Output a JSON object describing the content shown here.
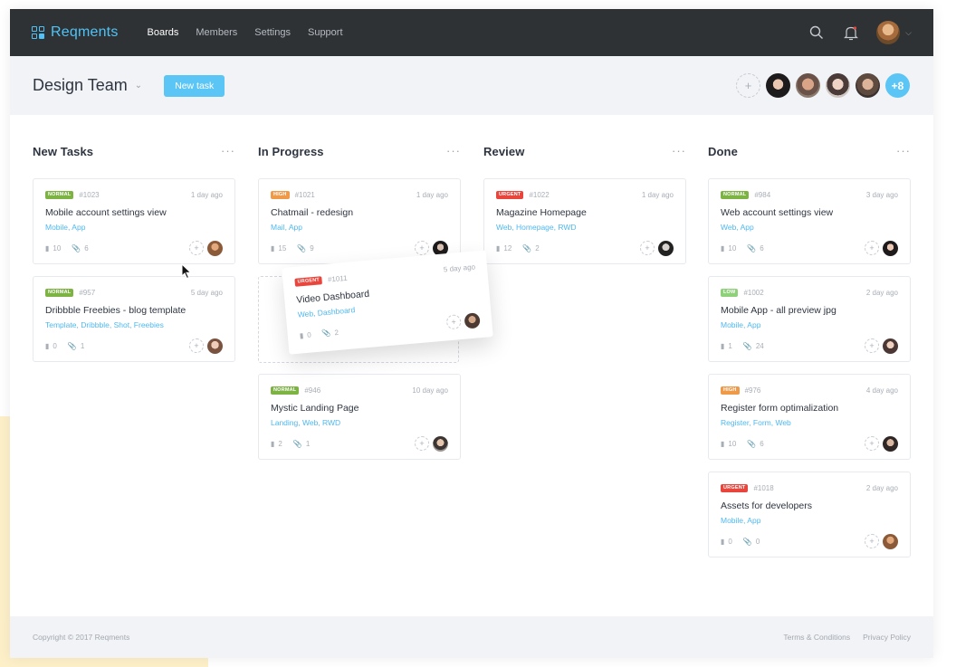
{
  "app": {
    "name": "Reqments"
  },
  "nav": {
    "links": [
      {
        "label": "Boards",
        "active": true
      },
      {
        "label": "Members",
        "active": false
      },
      {
        "label": "Settings",
        "active": false
      },
      {
        "label": "Support",
        "active": false
      }
    ],
    "icons": [
      "search-icon",
      "bell-icon",
      "chevron-down-icon"
    ]
  },
  "header": {
    "team_name": "Design Team",
    "new_task_label": "New task",
    "members_more": "+8",
    "add_member_symbol": "+"
  },
  "colors": {
    "accent": "#5bc5f5",
    "navbar": "#2f3234",
    "normal": "#7cb342",
    "high": "#ef9a48",
    "urgent": "#e8453c",
    "low": "#8fd07a"
  },
  "columns": [
    {
      "title": "New Tasks",
      "cards": [
        {
          "priority": "NORMAL",
          "id": "#1023",
          "time": "1 day ago",
          "title": "Mobile account settings view",
          "tags": "Mobile, App",
          "comments": "10",
          "attachments": "6"
        },
        {
          "priority": "NORMAL",
          "id": "#957",
          "time": "5 day ago",
          "title": "Dribbble Freebies - blog template",
          "tags": "Template, Dribbble, Shot, Freebies",
          "comments": "0",
          "attachments": "1"
        }
      ]
    },
    {
      "title": "In Progress",
      "cards": [
        {
          "priority": "HIGH",
          "id": "#1021",
          "time": "1 day ago",
          "title": "Chatmail - redesign",
          "tags": "Mail, App",
          "comments": "15",
          "attachments": "9"
        },
        {
          "priority": "NORMAL",
          "id": "#946",
          "time": "10 day ago",
          "title": "Mystic Landing Page",
          "tags": "Landing, Web, RWD",
          "comments": "2",
          "attachments": "1"
        }
      ]
    },
    {
      "title": "Review",
      "cards": [
        {
          "priority": "URGENT",
          "id": "#1022",
          "time": "1 day ago",
          "title": "Magazine Homepage",
          "tags": "Web, Homepage, RWD",
          "comments": "12",
          "attachments": "2"
        }
      ]
    },
    {
      "title": "Done",
      "cards": [
        {
          "priority": "NORMAL",
          "id": "#984",
          "time": "3 day ago",
          "title": "Web account settings view",
          "tags": "Web, App",
          "comments": "10",
          "attachments": "6"
        },
        {
          "priority": "LOW",
          "id": "#1002",
          "time": "2 day ago",
          "title": "Mobile App - all preview jpg",
          "tags": "Mobile, App",
          "comments": "1",
          "attachments": "24"
        },
        {
          "priority": "HIGH",
          "id": "#976",
          "time": "4 day ago",
          "title": "Register form optimalization",
          "tags": "Register, Form, Web",
          "comments": "10",
          "attachments": "6"
        },
        {
          "priority": "URGENT",
          "id": "#1018",
          "time": "2 day ago",
          "title": "Assets for developers",
          "tags": "Mobile, App",
          "comments": "0",
          "attachments": "0"
        }
      ]
    }
  ],
  "dragging": {
    "priority": "URGENT",
    "id": "#1011",
    "time": "5 day ago",
    "title": "Video Dashboard",
    "tags": "Web, Dashboard",
    "comments": "0",
    "attachments": "2"
  },
  "footer": {
    "copyright": "Copyright © 2017 Reqments",
    "links": [
      "Terms & Conditions",
      "Privacy Policy"
    ]
  }
}
